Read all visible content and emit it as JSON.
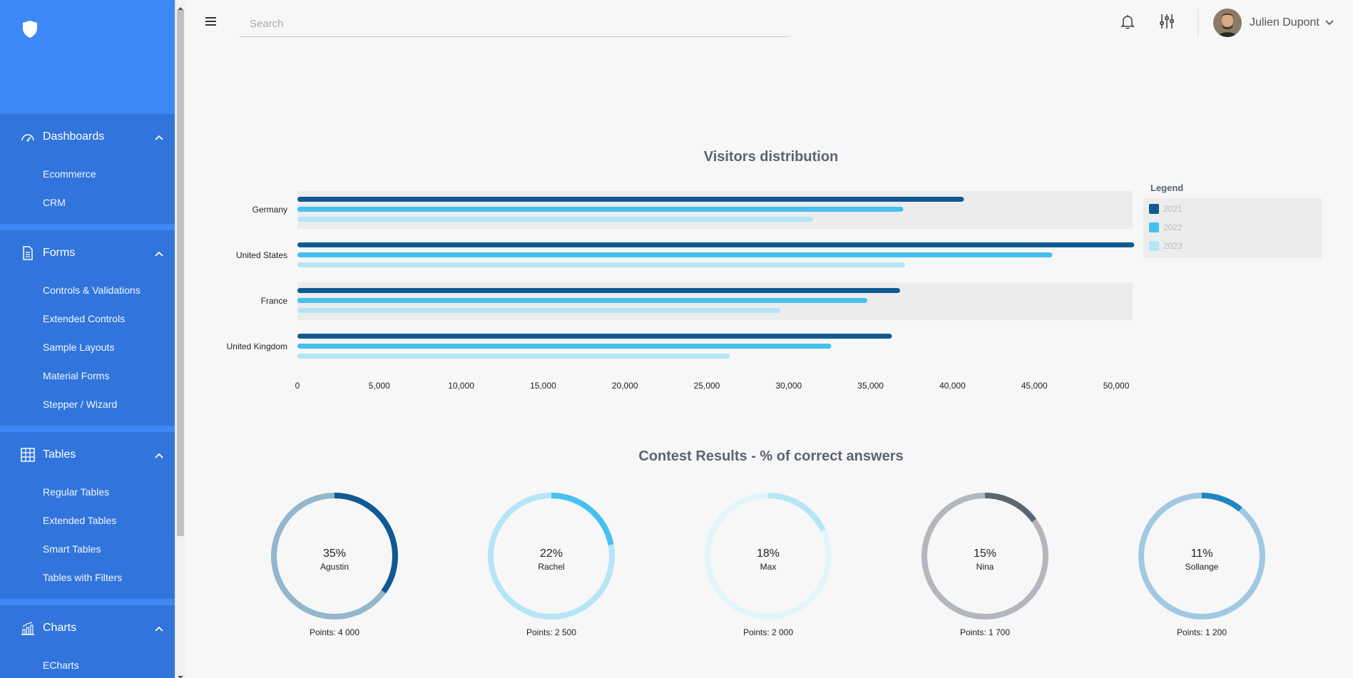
{
  "sidebar": {
    "groups": [
      {
        "label": "Dashboards",
        "icon": "gauge-icon",
        "items": [
          "Ecommerce",
          "CRM"
        ]
      },
      {
        "label": "Forms",
        "icon": "document-icon",
        "items": [
          "Controls & Validations",
          "Extended Controls",
          "Sample Layouts",
          "Material Forms",
          "Stepper / Wizard"
        ]
      },
      {
        "label": "Tables",
        "icon": "table-icon",
        "items": [
          "Regular Tables",
          "Extended Tables",
          "Smart Tables",
          "Tables with Filters"
        ]
      },
      {
        "label": "Charts",
        "icon": "bar-chart-icon",
        "items": [
          "ECharts"
        ]
      }
    ]
  },
  "topbar": {
    "search_placeholder": "Search",
    "user_name": "Julien Dupont"
  },
  "colors": {
    "sidebar": "#3a7fe6",
    "series_2021": "#0f5a93",
    "series_2022": "#45c1f0",
    "series_2023": "#b4e6f8"
  },
  "chart_data": [
    {
      "type": "bar",
      "orientation": "horizontal",
      "title": "Visitors distribution",
      "categories": [
        "Germany",
        "United States",
        "France",
        "United Kingdom"
      ],
      "series": [
        {
          "name": "2021",
          "color": "#0f5a93",
          "values": [
            40700,
            51100,
            36800,
            36300
          ]
        },
        {
          "name": "2022",
          "color": "#45c1f0",
          "values": [
            37000,
            46100,
            34800,
            32600
          ]
        },
        {
          "name": "2023",
          "color": "#b4e6f8",
          "values": [
            31500,
            37100,
            29500,
            26400
          ]
        }
      ],
      "xlim": [
        0,
        51000
      ],
      "x_ticks": [
        "0",
        "5,000",
        "10,000",
        "15,000",
        "20,000",
        "25,000",
        "30,000",
        "35,000",
        "40,000",
        "45,000",
        "50,000"
      ],
      "legend_title": "Legend",
      "legend_position": "right"
    },
    {
      "type": "pie",
      "title": "Contest Results - % of correct answers",
      "items": [
        {
          "name": "Agustin",
          "percent": 35,
          "percent_label": "35%",
          "points_label": "Points: 4 000",
          "color": "#0f5a93",
          "track": "#93b6cc"
        },
        {
          "name": "Rachel",
          "percent": 22,
          "percent_label": "22%",
          "points_label": "Points: 2 500",
          "color": "#45c1f0",
          "track": "#b6e5f8"
        },
        {
          "name": "Max",
          "percent": 18,
          "percent_label": "18%",
          "points_label": "Points: 2 000",
          "color": "#b4e6f8",
          "track": "#e2f5fc"
        },
        {
          "name": "Nina",
          "percent": 15,
          "percent_label": "15%",
          "points_label": "Points: 1 700",
          "color": "#5b6670",
          "track": "#b3b7bc"
        },
        {
          "name": "Sollange",
          "percent": 11,
          "percent_label": "11%",
          "points_label": "Points: 1 200",
          "color": "#1f86c4",
          "track": "#a0c9e1"
        }
      ]
    }
  ]
}
